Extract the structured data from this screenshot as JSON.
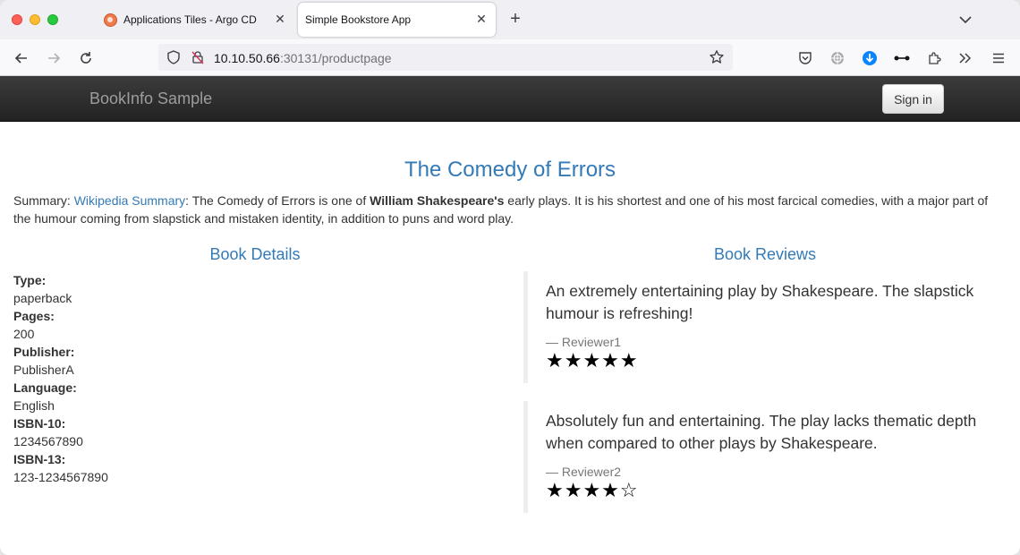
{
  "browser": {
    "tabs": [
      {
        "title": "Applications Tiles - Argo CD",
        "active": false
      },
      {
        "title": "Simple Bookstore App",
        "active": true
      }
    ],
    "url_host": "10.10.50.66",
    "url_path": ":30131/productpage",
    "close_glyph": "✕",
    "new_tab_glyph": "+"
  },
  "site": {
    "brand": "BookInfo Sample",
    "signin_label": "Sign in"
  },
  "book": {
    "title": "The Comedy of Errors",
    "summary_prefix": "Summary: ",
    "summary_link": "Wikipedia Summary",
    "summary_mid": ": The Comedy of Errors is one of ",
    "summary_bold": "William Shakespeare's",
    "summary_rest": " early plays. It is his shortest and one of his most farcical comedies, with a major part of the humour coming from slapstick and mistaken identity, in addition to puns and word play."
  },
  "details": {
    "heading": "Book Details",
    "items": [
      {
        "label": "Type:",
        "value": "paperback"
      },
      {
        "label": "Pages:",
        "value": "200"
      },
      {
        "label": "Publisher:",
        "value": "PublisherA"
      },
      {
        "label": "Language:",
        "value": "English"
      },
      {
        "label": "ISBN-10:",
        "value": "1234567890"
      },
      {
        "label": "ISBN-13:",
        "value": "123-1234567890"
      }
    ]
  },
  "reviews": {
    "heading": "Book Reviews",
    "items": [
      {
        "text": "An extremely entertaining play by Shakespeare. The slapstick humour is refreshing!",
        "reviewer": "— Reviewer1",
        "stars": "★★★★★",
        "rating": 5
      },
      {
        "text": "Absolutely fun and entertaining. The play lacks thematic depth when compared to other plays by Shakespeare.",
        "reviewer": "— Reviewer2",
        "stars": "★★★★☆",
        "rating": 4
      }
    ]
  }
}
